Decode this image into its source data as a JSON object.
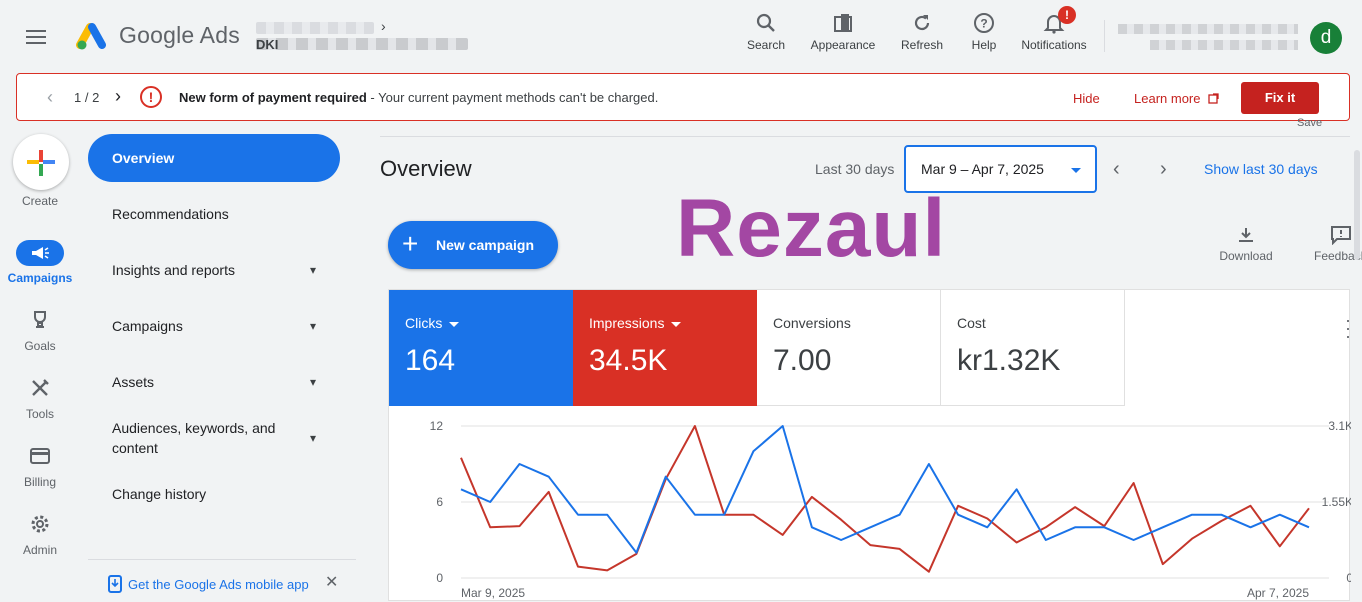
{
  "header": {
    "brand": "Google Ads",
    "account_prefix": "DKI",
    "tools": [
      {
        "label": "Search",
        "icon": "search-icon"
      },
      {
        "label": "Appearance",
        "icon": "appearance-icon"
      },
      {
        "label": "Refresh",
        "icon": "refresh-icon"
      },
      {
        "label": "Help",
        "icon": "help-icon"
      },
      {
        "label": "Notifications",
        "icon": "bell-icon",
        "badge": "!"
      }
    ],
    "avatar_letter": "d"
  },
  "alert": {
    "page": "1 / 2",
    "title": "New form of payment required",
    "message": " - Your current payment methods can't be charged.",
    "hide": "Hide",
    "learn_more": "Learn more",
    "fix": "Fix it"
  },
  "rail": {
    "create": "Create",
    "items": [
      "Campaigns",
      "Goals",
      "Tools",
      "Billing",
      "Admin"
    ],
    "active": "Campaigns"
  },
  "nav": {
    "items": [
      "Overview",
      "Recommendations",
      "Insights and reports",
      "Campaigns",
      "Assets",
      "Audiences, keywords, and content",
      "Change history"
    ],
    "mobile_app": "Get the Google Ads mobile app"
  },
  "main": {
    "save": "Save",
    "title": "Overview",
    "range_label": "Last 30 days",
    "date_range": "Mar 9 – Apr 7, 2025",
    "show_last": "Show last 30 days",
    "new_campaign": "New campaign",
    "watermark": "Rezaul",
    "download": "Download",
    "feedback": "Feedback"
  },
  "scorecards": [
    {
      "title": "Clicks",
      "value": "164",
      "color": "#1a73e8"
    },
    {
      "title": "Impressions",
      "value": "34.5K",
      "color": "#d93025"
    },
    {
      "title": "Conversions",
      "value": "7.00"
    },
    {
      "title": "Cost",
      "value": "kr1.32K"
    }
  ],
  "chart_data": {
    "type": "line",
    "x_start": "Mar 9, 2025",
    "x_end": "Apr 7, 2025",
    "left_axis": {
      "ticks": [
        "0",
        "6",
        "12"
      ],
      "ylim": [
        0,
        12
      ]
    },
    "right_axis": {
      "ticks": [
        "0",
        "1.55K",
        "3.1K"
      ],
      "ylim": [
        0,
        3100
      ]
    },
    "series": [
      {
        "name": "Clicks",
        "color": "#1a73e8",
        "axis": "left",
        "values": [
          7,
          6,
          9,
          8,
          5,
          5,
          2,
          8,
          5,
          5,
          10,
          12,
          4,
          3,
          4,
          5,
          9,
          5,
          4,
          7,
          3,
          4,
          4,
          3,
          4,
          5,
          5,
          4,
          5,
          4
        ]
      },
      {
        "name": "Impressions",
        "color": "#c5362b",
        "axis": "left",
        "values": [
          9.5,
          4,
          4.1,
          6.8,
          0.9,
          0.6,
          1.9,
          7.8,
          12,
          5,
          5,
          3.4,
          6.4,
          4.6,
          2.6,
          2.3,
          0.5,
          5.7,
          4.7,
          2.8,
          4,
          5.6,
          4.1,
          7.5,
          1.1,
          3.1,
          4.5,
          5.7,
          2.5,
          5.5
        ]
      }
    ]
  }
}
